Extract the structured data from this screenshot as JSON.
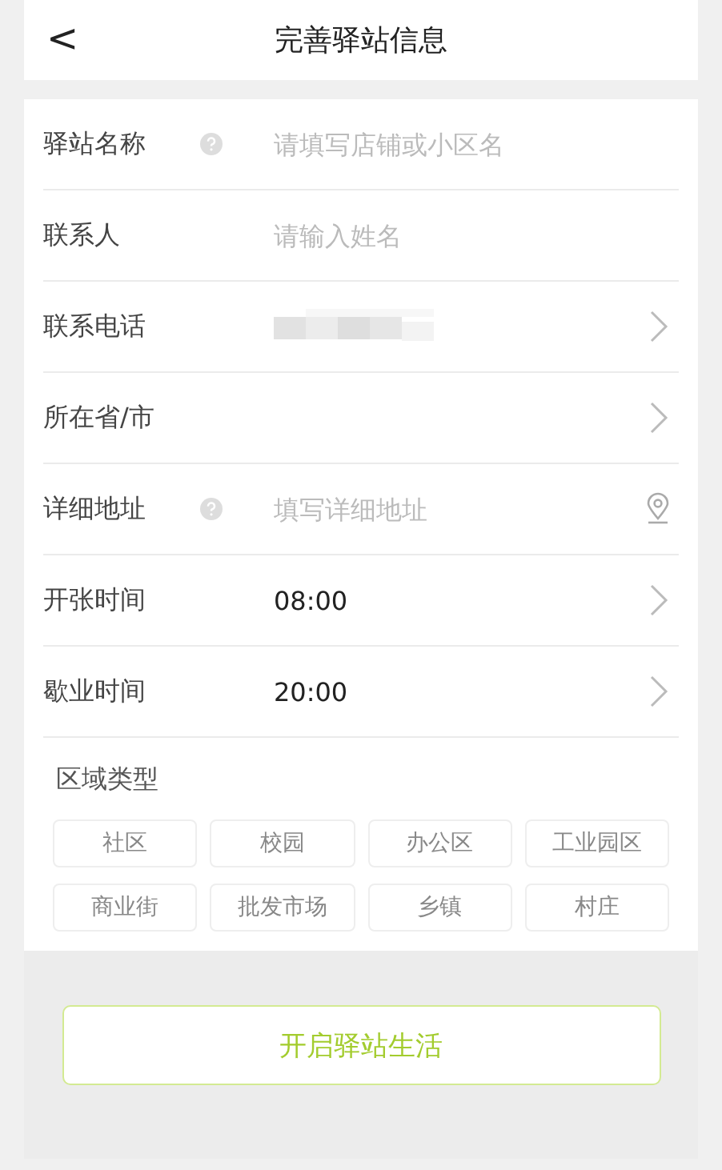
{
  "header": {
    "back": "<",
    "title": "完善驿站信息"
  },
  "fields": [
    {
      "kind": "input",
      "label": "驿站名称",
      "help": true,
      "placeholder": "请填写店铺或小区名"
    },
    {
      "kind": "input",
      "label": "联系人",
      "help": false,
      "placeholder": "请输入姓名"
    },
    {
      "kind": "picker",
      "label": "联系电话",
      "help": false,
      "redacted": true
    },
    {
      "kind": "picker",
      "label": "所在省/市",
      "help": false
    },
    {
      "kind": "address",
      "label": "详细地址",
      "help": true,
      "placeholder": "填写详细地址"
    },
    {
      "kind": "picker",
      "label": "开张时间",
      "help": false,
      "value": "08:00"
    },
    {
      "kind": "picker",
      "label": "歇业时间",
      "help": false,
      "value": "20:00"
    }
  ],
  "area_type": {
    "label": "区域类型",
    "options": [
      {
        "label": "社区",
        "selected": false
      },
      {
        "label": "校园",
        "selected": false
      },
      {
        "label": "办公区",
        "selected": false
      },
      {
        "label": "工业园区",
        "selected": false
      },
      {
        "label": "商业街",
        "selected": false
      },
      {
        "label": "批发市场",
        "selected": false
      },
      {
        "label": "乡镇",
        "selected": false
      },
      {
        "label": "村庄",
        "selected": false
      }
    ]
  },
  "submit": "开启驿站生活"
}
